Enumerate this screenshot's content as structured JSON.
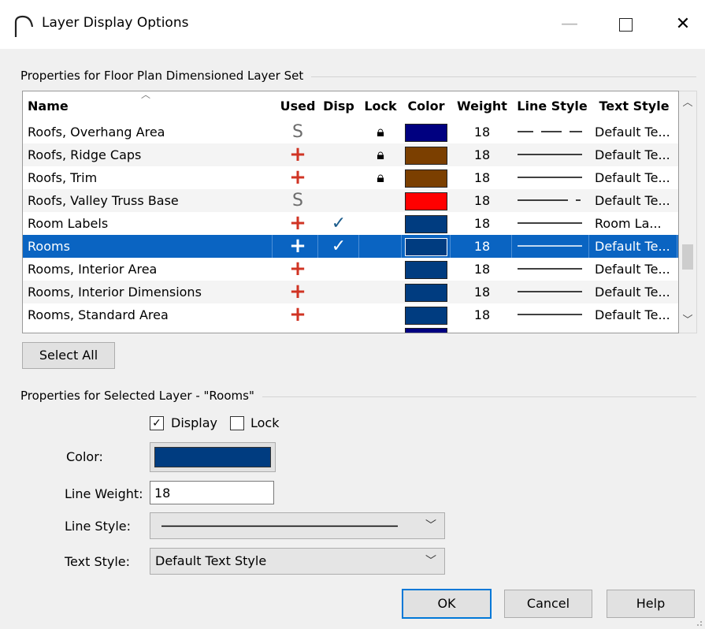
{
  "window": {
    "title": "Layer Display Options",
    "minimize": "—",
    "close": "✕"
  },
  "layer_set_group": {
    "label": "Properties for Floor Plan Dimensioned Layer Set"
  },
  "grid": {
    "headers": [
      "Name",
      "Used",
      "Disp",
      "Lock",
      "Color",
      "Weight",
      "Line Style",
      "Text Style"
    ],
    "rows": [
      {
        "name": "Roofs, Overhang Area",
        "used": "S",
        "disp": "",
        "lock": true,
        "color": "#000080",
        "weight": "18",
        "line_style": "dashed",
        "text_style": "Default Te..."
      },
      {
        "name": "Roofs, Ridge Caps",
        "used": "+",
        "disp": "",
        "lock": true,
        "color": "#7b3f00",
        "weight": "18",
        "line_style": "solid",
        "text_style": "Default Te..."
      },
      {
        "name": "Roofs, Trim",
        "used": "+",
        "disp": "",
        "lock": true,
        "color": "#7b3f00",
        "weight": "18",
        "line_style": "solid",
        "text_style": "Default Te..."
      },
      {
        "name": "Roofs, Valley Truss Base",
        "used": "S",
        "disp": "",
        "lock": false,
        "color": "#ff0000",
        "weight": "18",
        "line_style": "long-dash",
        "text_style": "Default Te..."
      },
      {
        "name": "Room Labels",
        "used": "+",
        "disp": "✓",
        "lock": false,
        "color": "#003c80",
        "weight": "18",
        "line_style": "solid",
        "text_style": "Room La..."
      },
      {
        "name": "Rooms",
        "used": "+",
        "disp": "✓",
        "lock": false,
        "color": "#003c80",
        "weight": "18",
        "line_style": "solid",
        "text_style": "Default Te...",
        "selected": true
      },
      {
        "name": "Rooms, Interior Area",
        "used": "+",
        "disp": "",
        "lock": false,
        "color": "#003c80",
        "weight": "18",
        "line_style": "solid",
        "text_style": "Default Te..."
      },
      {
        "name": "Rooms, Interior Dimensions",
        "used": "+",
        "disp": "",
        "lock": false,
        "color": "#003c80",
        "weight": "18",
        "line_style": "solid",
        "text_style": "Default Te..."
      },
      {
        "name": "Rooms, Standard Area",
        "used": "+",
        "disp": "",
        "lock": false,
        "color": "#003c80",
        "weight": "18",
        "line_style": "solid",
        "text_style": "Default Te..."
      }
    ]
  },
  "buttons": {
    "select_all": "Select All",
    "ok": "OK",
    "cancel": "Cancel",
    "help": "Help"
  },
  "selected_group": {
    "label": "Properties for Selected Layer - \"Rooms\"",
    "display_label": "Display",
    "display_checked": true,
    "lock_label": "Lock",
    "lock_checked": false,
    "color_label": "Color:",
    "color_value": "#003c80",
    "line_weight_label": "Line Weight:",
    "line_weight_value": "18",
    "line_style_label": "Line Style:",
    "text_style_label": "Text Style:",
    "text_style_value": "Default Text Style"
  },
  "colors": {
    "selection": "#0a64c2",
    "used_plus": "#d03424",
    "check": "#1b5c8c"
  }
}
